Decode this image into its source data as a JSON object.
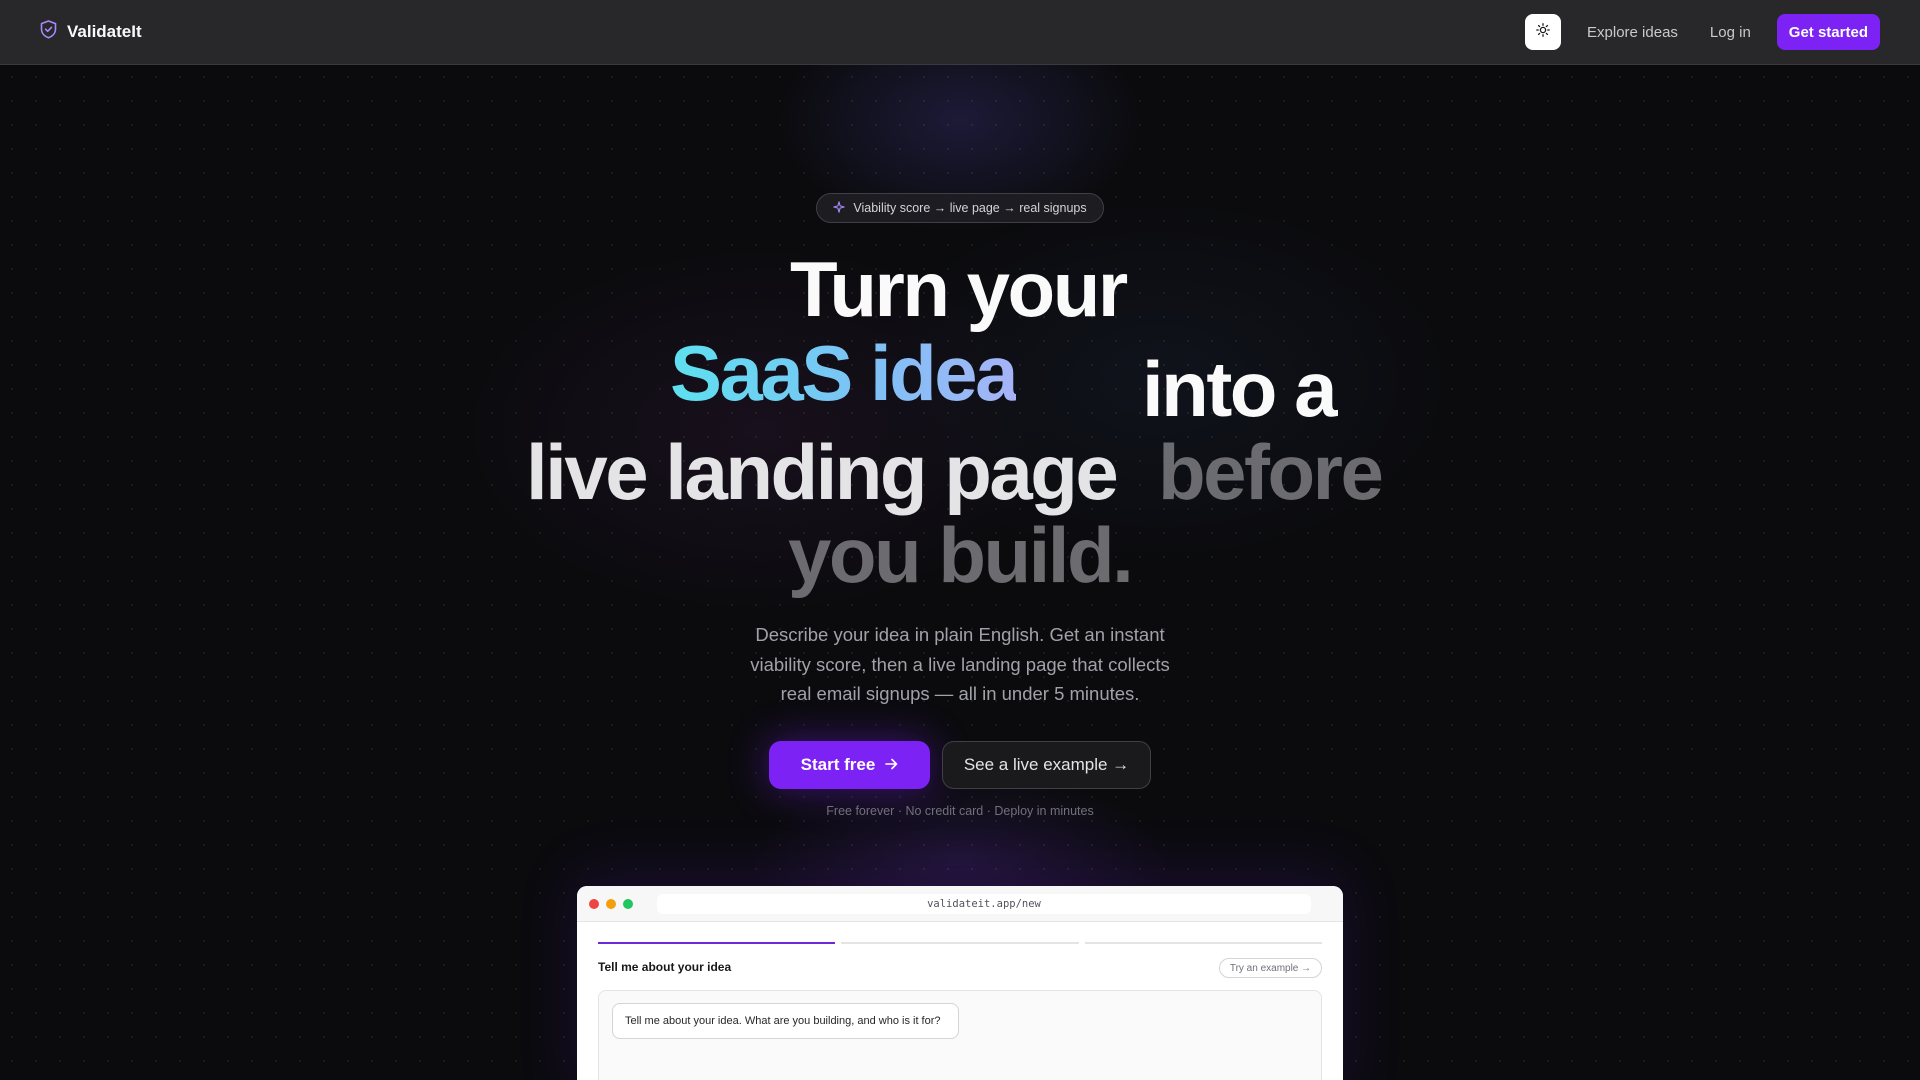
{
  "nav": {
    "brand": "ValidateIt",
    "links": [
      "Explore ideas",
      "Log in"
    ],
    "cta": "Get started",
    "icons": {
      "brand": "shield-icon",
      "theme": "sun-icon"
    }
  },
  "hero": {
    "pill": "Viability score → live page → real signups",
    "headline": {
      "line1": "Turn your",
      "accent": "SaaS idea",
      "line2b": "into a",
      "line3a": "live landing page",
      "line3b": "before",
      "line4": "you build."
    },
    "subtitle": "Describe your idea in plain English. Get an instant viability score, then a live landing page that collects real email signups — all in under 5 minutes.",
    "primary_cta": "Start free",
    "secondary_cta": "See a live example →",
    "fineprint": "Free forever · No credit card · Deploy in minutes"
  },
  "mock": {
    "url": "validateit.app/new",
    "title": "Tell me about your idea",
    "try_example": "Try an example →",
    "prompt": "Tell me about your idea. What are you building, and who is it for?"
  },
  "colors": {
    "accent": "#7c22f5",
    "nav_bg": "#28282b",
    "page_bg": "#0b0b0e",
    "gradient_start": "#5ee0f0",
    "gradient_end": "#a7b4f7"
  }
}
